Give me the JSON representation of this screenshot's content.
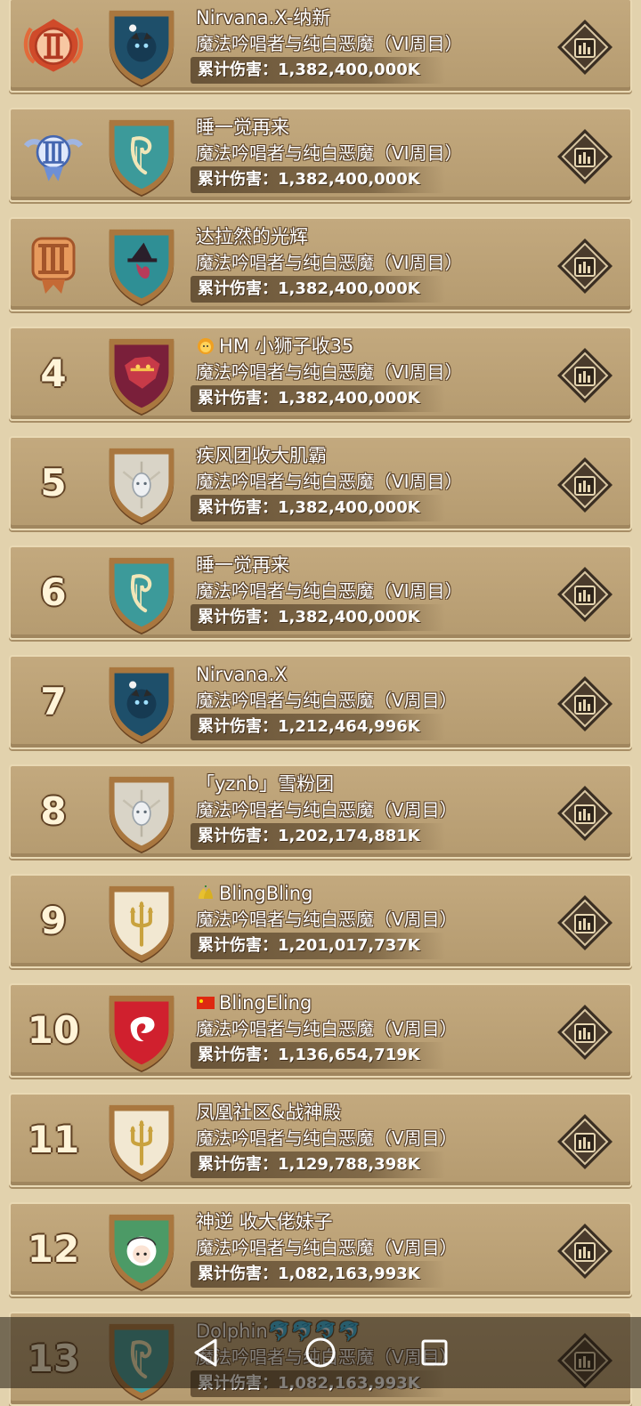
{
  "rows": [
    {
      "rank": "1",
      "rank_badge": "rank-1-wing-badge",
      "crest": "dark-demon-crest",
      "crest_icon": "demon-face-icon",
      "name_icon": "",
      "name": "Nirvana.X-纳新",
      "boss": "魔法吟唱者与纯白恶魔（VI周目）",
      "damage": "累计伤害：1,382,400,000K"
    },
    {
      "rank": "2",
      "rank_badge": "rank-2-wing-badge",
      "crest": "harp-crest",
      "crest_icon": "harp-icon",
      "name_icon": "",
      "name": "睡一觉再来",
      "boss": "魔法吟唱者与纯白恶魔（VI周目）",
      "damage": "累计伤害：1,382,400,000K"
    },
    {
      "rank": "3",
      "rank_badge": "rank-3-badge",
      "crest": "witch-crest",
      "crest_icon": "witch-icon",
      "name_icon": "",
      "name": "达拉然的光辉",
      "boss": "魔法吟唱者与纯白恶魔（VI周目）",
      "damage": "累计伤害：1,382,400,000K"
    },
    {
      "rank": "4",
      "rank_badge": "",
      "crest": "dragon-crest",
      "crest_icon": "dragon-icon",
      "name_icon": "lion-emoji-icon",
      "name": "HM 小狮子收35",
      "boss": "魔法吟唱者与纯白恶魔（VI周目）",
      "damage": "累计伤害：1,382,400,000K"
    },
    {
      "rank": "5",
      "rank_badge": "",
      "crest": "silver-crest",
      "crest_icon": "silver-mask-icon",
      "name_icon": "",
      "name": "疾风团收大肌霸",
      "boss": "魔法吟唱者与纯白恶魔（VI周目）",
      "damage": "累计伤害：1,382,400,000K"
    },
    {
      "rank": "6",
      "rank_badge": "",
      "crest": "harp-crest",
      "crest_icon": "harp-icon",
      "name_icon": "",
      "name": "睡一觉再来",
      "boss": "魔法吟唱者与纯白恶魔（VI周目）",
      "damage": "累计伤害：1,382,400,000K"
    },
    {
      "rank": "7",
      "rank_badge": "",
      "crest": "dark-demon-crest",
      "crest_icon": "demon-face-icon",
      "name_icon": "",
      "name": "Nirvana.X",
      "boss": "魔法吟唱者与纯白恶魔（V周目）",
      "damage": "累计伤害：1,212,464,996K"
    },
    {
      "rank": "8",
      "rank_badge": "",
      "crest": "silver-crest",
      "crest_icon": "silver-mask-icon",
      "name_icon": "",
      "name": "「yznb」雪粉团",
      "boss": "魔法吟唱者与纯白恶魔（V周目）",
      "damage": "累计伤害：1,202,174,881K"
    },
    {
      "rank": "9",
      "rank_badge": "",
      "crest": "trident-crest",
      "crest_icon": "trident-icon",
      "name_icon": "bells-emoji-icon",
      "name": "BlingBling",
      "boss": "魔法吟唱者与纯白恶魔（V周目）",
      "damage": "累计伤害：1,201,017,737K"
    },
    {
      "rank": "10",
      "rank_badge": "",
      "crest": "red-dragon-crest",
      "crest_icon": "red-dragon-icon",
      "name_icon": "china-flag-icon",
      "name": "BlingEling",
      "boss": "魔法吟唱者与纯白恶魔（V周目）",
      "damage": "累计伤害：1,136,654,719K"
    },
    {
      "rank": "11",
      "rank_badge": "",
      "crest": "trident-crest",
      "crest_icon": "trident-icon",
      "name_icon": "",
      "name": "凤凰社区&战神殿",
      "boss": "魔法吟唱者与纯白恶魔（V周目）",
      "damage": "累计伤害：1,129,788,398K"
    },
    {
      "rank": "12",
      "rank_badge": "",
      "crest": "girl-crest",
      "crest_icon": "girl-face-icon",
      "name_icon": "",
      "name": "神逆 收大佬妹子",
      "boss": "魔法吟唱者与纯白恶魔（V周目）",
      "damage": "累计伤害：1,082,163,993K"
    },
    {
      "rank": "13",
      "rank_badge": "",
      "crest": "harp-crest",
      "crest_icon": "harp-icon",
      "name_icon": "",
      "name": "Dolphin🐬🐬🐬🐬",
      "boss": "魔法吟唱者与纯白恶魔（V周目）",
      "damage": "累计伤害：1,082,163,993K"
    }
  ],
  "navbar": {
    "back": "back-triangle-icon",
    "home": "home-circle-icon",
    "recents": "recents-square-icon"
  },
  "colors": {
    "card": "#bda57b",
    "card_border": "#e9d9b4",
    "text": "#ffffff",
    "text_outline": "#5a4128",
    "stats_button": "#3a2e22"
  }
}
